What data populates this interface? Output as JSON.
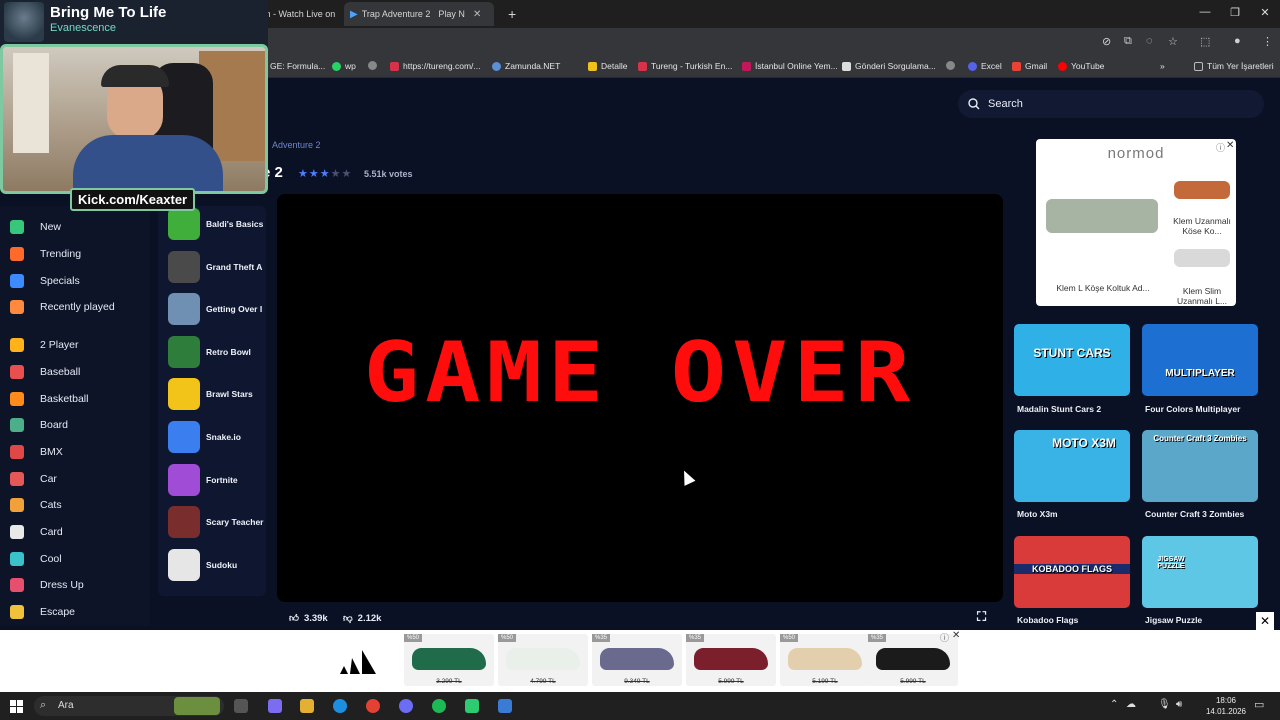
{
  "webcam": {
    "song_title": "Bring Me To Life",
    "artist": "Evanescence",
    "channel": "Kick.com/Keaxter"
  },
  "browser": {
    "tabs": [
      {
        "label": "Keaxter Stream - Watch Live on"
      },
      {
        "label": "Trap Adventure 2"
      },
      {
        "label": "Play N"
      }
    ],
    "url": "trap-adventure-2",
    "bookmarks": [
      {
        "label": "GE: Formula..."
      },
      {
        "label": "wp"
      },
      {
        "label": "https://tureng.com/..."
      },
      {
        "label": "Zamunda.NET"
      },
      {
        "label": "Detalle"
      },
      {
        "label": "Tureng - Turkish En..."
      },
      {
        "label": "İstanbul Online Yem..."
      },
      {
        "label": "Gönderi Sorgulama..."
      },
      {
        "label": "Excel"
      },
      {
        "label": "Gmail"
      },
      {
        "label": "YouTube"
      },
      {
        "label": "Tüm Yer İşaretleri"
      }
    ]
  },
  "search": {
    "placeholder": "Search"
  },
  "game": {
    "breadcrumb": "Adventure 2",
    "title": "e 2",
    "rating_stars": 3,
    "votes": "5.51k votes",
    "screen_text": "GAME OVER",
    "likes": "3.39k",
    "dislikes": "2.12k"
  },
  "left_nav": [
    {
      "label": "New",
      "color": "#36c77a"
    },
    {
      "label": "Trending",
      "color": "#ff6a2a"
    },
    {
      "label": "Specials",
      "color": "#3d8bff"
    },
    {
      "label": "Recently played",
      "color": "#ff8a3d"
    },
    {
      "label": "2 Player",
      "color": "#ffb21a"
    },
    {
      "label": "Baseball",
      "color": "#e94f4f"
    },
    {
      "label": "Basketball",
      "color": "#ff8c1a"
    },
    {
      "label": "Board",
      "color": "#4caf8a"
    },
    {
      "label": "BMX",
      "color": "#e04848"
    },
    {
      "label": "Car",
      "color": "#e65757"
    },
    {
      "label": "Cats",
      "color": "#f2a03a"
    },
    {
      "label": "Card",
      "color": "#e8e8e8"
    },
    {
      "label": "Cool",
      "color": "#3bc1c9"
    },
    {
      "label": "Dress Up",
      "color": "#e6506e"
    },
    {
      "label": "Escape",
      "color": "#f0c23c"
    }
  ],
  "popular_games": [
    {
      "label": "Baldi's Basics",
      "color": "#3fae3a"
    },
    {
      "label": "Grand Theft A",
      "color": "#4a4a4a"
    },
    {
      "label": "Getting Over I",
      "color": "#6f8fb3"
    },
    {
      "label": "Retro Bowl",
      "color": "#2f7d3a"
    },
    {
      "label": "Brawl Stars",
      "color": "#f2c41a"
    },
    {
      "label": "Snake.io",
      "color": "#3a7ef0"
    },
    {
      "label": "Fortnite",
      "color": "#a04cd6"
    },
    {
      "label": "Scary Teacher",
      "color": "#7a2d2d"
    },
    {
      "label": "Sudoku",
      "color": "#e6e6e6"
    }
  ],
  "ad_box": {
    "brand": "normod",
    "item1": "Klem L Köşe Koltuk Ad...",
    "item2": "Klem Uzanmalı Köse Ko...",
    "item3": "Klem Slim Uzanmalı L..."
  },
  "related_games": [
    {
      "label": "Madalin Stunt Cars 2",
      "thumb": "STUNT CARS",
      "color": "#2fb1e8"
    },
    {
      "label": "Four Colors Multiplayer",
      "thumb": "MULTIPLAYER",
      "color": "#1d6fd1"
    },
    {
      "label": "Moto X3m",
      "thumb": "MOTO X3M",
      "color": "#39b3e6"
    },
    {
      "label": "Counter Craft 3 Zombies",
      "thumb": "Counter Craft 3 Zombies",
      "color": "#5aa7c9"
    },
    {
      "label": "Kobadoo Flags",
      "thumb": "KOBADOO FLAGS",
      "color": "#d93a3a"
    },
    {
      "label": "Jigsaw Puzzle",
      "thumb": "JIGSAW PUZZLE",
      "color": "#5ec7e6"
    }
  ],
  "banner": {
    "shoes": [
      {
        "discount": "%50",
        "price": "3.299 TL",
        "color": "#1f6b4a"
      },
      {
        "discount": "%50",
        "price": "4.799 TL",
        "color": "#e9efe9"
      },
      {
        "discount": "%35",
        "price": "9.349 TL",
        "color": "#6a6a8e"
      },
      {
        "discount": "%35",
        "price": "5.999 TL",
        "color": "#7a1f2b"
      },
      {
        "discount": "%50",
        "price": "5.199 TL",
        "color": "#e3cfad"
      },
      {
        "discount": "%35",
        "price": "5.999 TL",
        "color": "#1b1b1b"
      }
    ]
  },
  "taskbar": {
    "search_label": "Ara",
    "time": "18:06",
    "date": "14.01.2026"
  }
}
